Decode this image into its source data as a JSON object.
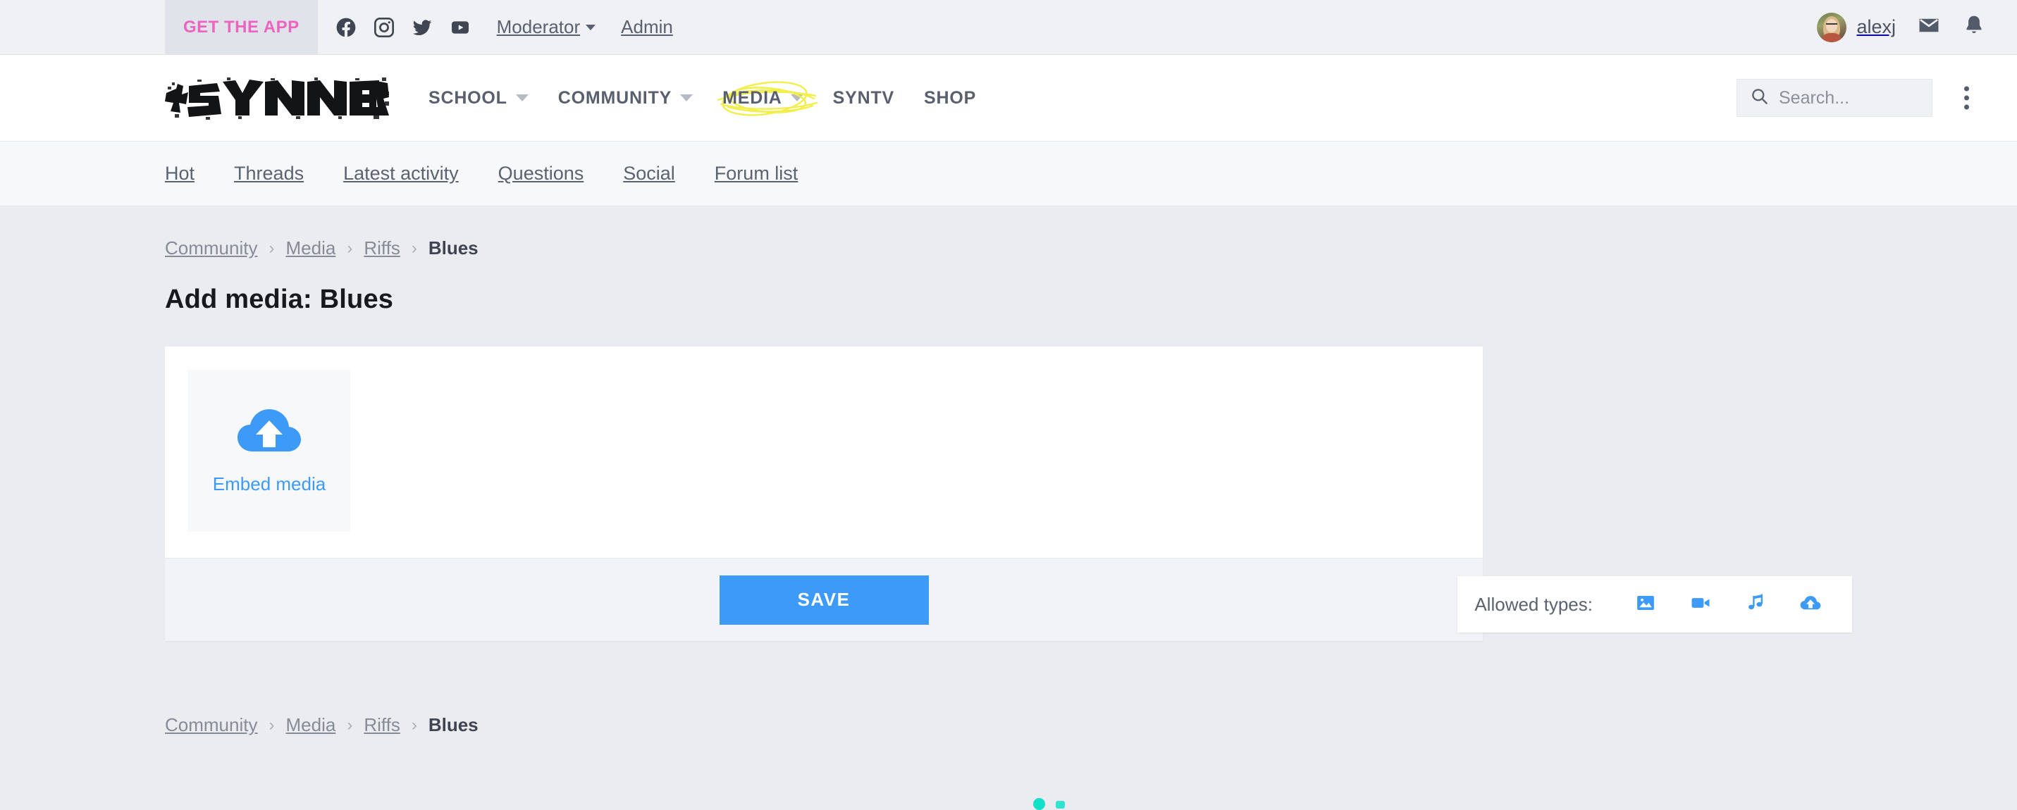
{
  "topbar": {
    "get_the_app": "GET THE APP",
    "social": [
      {
        "name": "facebook-icon"
      },
      {
        "name": "instagram-icon"
      },
      {
        "name": "twitter-icon"
      },
      {
        "name": "youtube-icon"
      }
    ],
    "links": [
      {
        "label": "Moderator",
        "has_caret": true
      },
      {
        "label": "Admin",
        "has_caret": false
      }
    ],
    "username": "alexj",
    "mail_icon": "mail-icon",
    "bell_icon": "bell-icon"
  },
  "header": {
    "logo_text": "SYNNER",
    "nav": [
      {
        "label": "SCHOOL",
        "caret": true,
        "highlight": false
      },
      {
        "label": "COMMUNITY",
        "caret": true,
        "highlight": false
      },
      {
        "label": "MEDIA",
        "caret": true,
        "highlight": true
      },
      {
        "label": "SYNTV",
        "caret": false,
        "highlight": false
      },
      {
        "label": "SHOP",
        "caret": false,
        "highlight": false
      }
    ],
    "search": {
      "placeholder": "Search...",
      "value": "",
      "icon": "search-icon"
    },
    "kebab_icon": "more-vertical-icon"
  },
  "subnav": {
    "items": [
      {
        "label": "Hot"
      },
      {
        "label": "Threads"
      },
      {
        "label": "Latest activity"
      },
      {
        "label": "Questions"
      },
      {
        "label": "Social"
      },
      {
        "label": "Forum list"
      }
    ]
  },
  "breadcrumb": {
    "items": [
      {
        "label": "Community",
        "active": false
      },
      {
        "label": "Media",
        "active": false
      },
      {
        "label": "Riffs",
        "active": false
      },
      {
        "label": "Blues",
        "active": true
      }
    ],
    "separator": "›"
  },
  "main": {
    "title": "Add media: Blues",
    "upload": {
      "icon": "cloud-upload-icon",
      "label": "Embed media"
    },
    "save_label": "SAVE"
  },
  "allowed_types": {
    "label": "Allowed types:",
    "icons": [
      {
        "name": "image-icon"
      },
      {
        "name": "video-camera-icon"
      },
      {
        "name": "music-note-icon"
      },
      {
        "name": "cloud-upload-icon"
      }
    ]
  },
  "colors": {
    "accent_blue": "#3d9bf7",
    "pink": "#ed63c0",
    "highlight_yellow": "#f2ee4a",
    "page_bg": "#eaecf0",
    "text_muted": "#5b6270"
  }
}
